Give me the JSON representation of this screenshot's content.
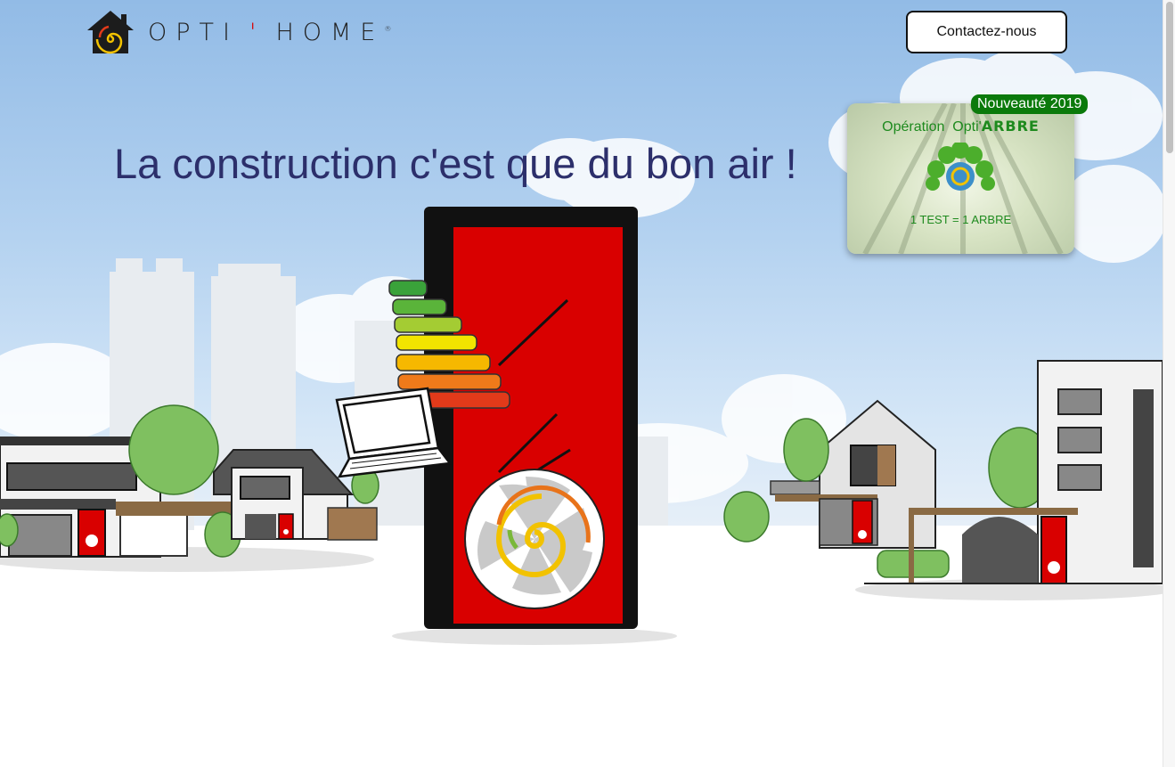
{
  "header": {
    "logo_text": "OPTI",
    "logo_apostrophe": "'",
    "logo_text2": "HOME",
    "logo_registered": "®",
    "contact_button": "Contactez-nous"
  },
  "hero": {
    "headline": "La construction c'est que du bon air !"
  },
  "promo": {
    "badge": "Nouveauté 2019",
    "operation_prefix": "Opération",
    "operation_name": "Opti'",
    "operation_name_bold": "ARBRE",
    "tagline": "1 TEST = 1 ARBRE"
  },
  "colors": {
    "headline": "#2c2f6b",
    "badge_bg": "#0b7a0b",
    "promo_text": "#1e8a1e",
    "door_red": "#d90000"
  }
}
